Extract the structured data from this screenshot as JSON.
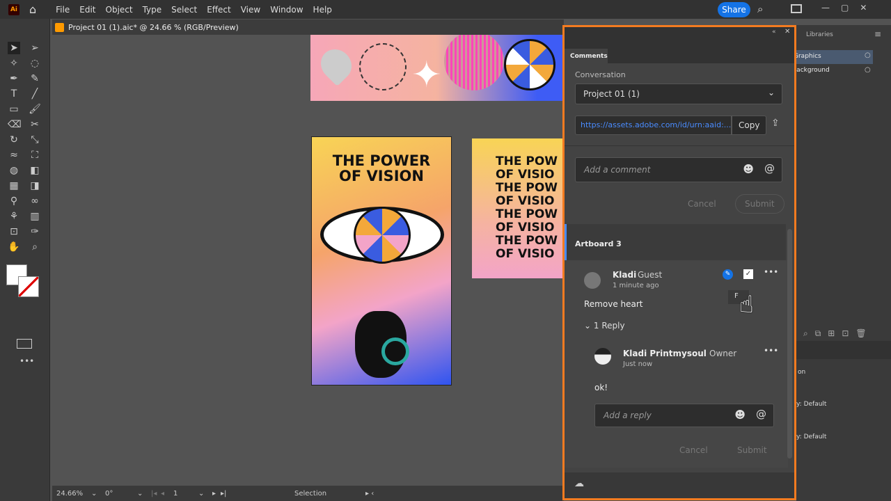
{
  "app": {
    "logo": "Ai",
    "menu": [
      "File",
      "Edit",
      "Object",
      "Type",
      "Select",
      "Effect",
      "View",
      "Window",
      "Help"
    ],
    "share_label": "Share"
  },
  "document": {
    "tab_title": "Project 01 (1).aic* @ 24.66 % (RGB/Preview)"
  },
  "artwork": {
    "poster_title_line1": "THE POWER",
    "poster_title_line2": "OF VISION",
    "poster2_lines": [
      "THE POW",
      "OF VISIO",
      "THE POW",
      "OF VISIO",
      "THE POW",
      "OF VISIO",
      "THE POW",
      "OF VISIO"
    ]
  },
  "status": {
    "zoom": "24.66%",
    "rotation": "0°",
    "artboard": "1",
    "tool": "Selection"
  },
  "comments_panel": {
    "tab": "Comments",
    "conversation_label": "Conversation",
    "conversation_value": "Project 01 (1)",
    "link": "https://assets.adobe.com/id/urn:aaid:...",
    "copy_label": "Copy",
    "comment_placeholder": "Add a comment",
    "cancel_label": "Cancel",
    "submit_label": "Submit",
    "section": "Artboard 3",
    "comment": {
      "author": "Kladi",
      "role": "Guest",
      "time": "1 minute ago",
      "text": "Remove heart",
      "replies_toggle": "1 Reply",
      "tooltip": "F"
    },
    "reply": {
      "author": "Kladi Printmysoul",
      "role": "Owner",
      "time": "Just now",
      "text": "ok!"
    },
    "reply_placeholder": "Add a reply",
    "reply_cancel": "Cancel",
    "reply_submit": "Submit"
  },
  "right_panel": {
    "tab": "Libraries",
    "layers": [
      "Graphics",
      "Background"
    ],
    "props": [
      "on",
      "y: Default",
      "y: Default"
    ]
  },
  "colors": {
    "accent": "#f47b20",
    "link": "#4a8cff",
    "share": "#1473e6"
  }
}
